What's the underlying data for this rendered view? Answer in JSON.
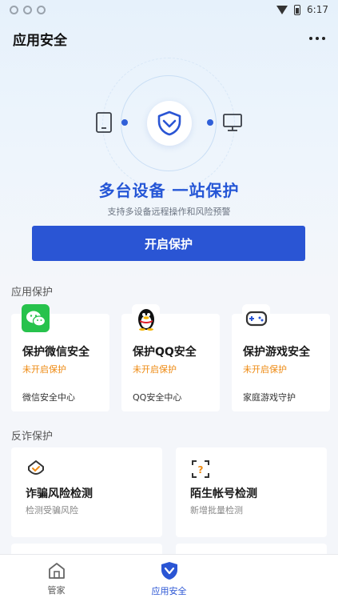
{
  "status_bar": {
    "time": "6:17"
  },
  "header": {
    "title": "应用安全"
  },
  "hero": {
    "headline": "多台设备  一站保护",
    "subtitle": "支持多设备远程操作和风险预警",
    "button_label": "开启保护"
  },
  "app_protection": {
    "section_label": "应用保护",
    "cards": [
      {
        "title": "保护微信安全",
        "status": "未开启保护",
        "link": "微信安全中心",
        "icon": "wechat-icon"
      },
      {
        "title": "保护QQ安全",
        "status": "未开启保护",
        "link": "QQ安全中心",
        "icon": "qq-penguin-icon"
      },
      {
        "title": "保护游戏安全",
        "status": "未开启保护",
        "link": "家庭游戏守护",
        "icon": "gamepad-icon"
      }
    ]
  },
  "anti_fraud": {
    "section_label": "反诈保护",
    "cards": [
      {
        "title": "诈骗风险检测",
        "subtitle": "检测受骗风险",
        "icon": "fraud-detect-icon"
      },
      {
        "title": "陌生帐号检测",
        "subtitle": "新增批量检测",
        "icon": "unknown-account-icon"
      }
    ]
  },
  "bottom_nav": {
    "items": [
      {
        "label": "管家",
        "icon": "home-icon"
      },
      {
        "label": "应用安全",
        "icon": "shield-nav-icon",
        "active": true
      }
    ]
  },
  "colors": {
    "accent": "#2a55d4",
    "warning": "#ee8a12",
    "wechat": "#27c24c"
  }
}
